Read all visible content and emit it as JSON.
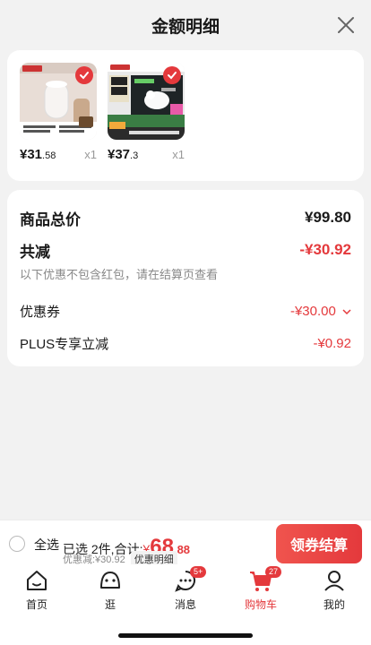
{
  "header": {
    "title": "金额明细"
  },
  "products": [
    {
      "price_main": "¥31",
      "price_dec": ".58",
      "qty": "x1",
      "image": "product-humidifier"
    },
    {
      "price_main": "¥37",
      "price_dec": ".3",
      "qty": "x1",
      "image": "product-milk-box"
    }
  ],
  "summary": {
    "total_label": "商品总价",
    "total_value": "¥99.80",
    "discount_label": "共减",
    "discount_value": "-¥30.92",
    "note": "以下优惠不包含红包，请在结算页查看",
    "coupon_label": "优惠券",
    "coupon_value": "-¥30.00",
    "plus_label": "PLUS专享立减",
    "plus_value": "-¥0.92"
  },
  "bottom": {
    "select_all": "全选",
    "selected_text": "已选 2件,合计:",
    "yen": "¥",
    "amount_main": "68",
    "amount_dec": ".88",
    "discount_text": "优惠减:¥30.92",
    "detail_link": "优惠明细",
    "checkout_label": "领券结算"
  },
  "tabs": [
    {
      "label": "首页",
      "icon": "home-icon"
    },
    {
      "label": "逛",
      "icon": "explore-icon"
    },
    {
      "label": "消息",
      "icon": "message-icon",
      "badge": "5+"
    },
    {
      "label": "购物车",
      "icon": "cart-icon",
      "badge": "27",
      "active": true
    },
    {
      "label": "我的",
      "icon": "profile-icon"
    }
  ],
  "colors": {
    "accent": "#e4393c",
    "background": "#f2f2f2"
  }
}
